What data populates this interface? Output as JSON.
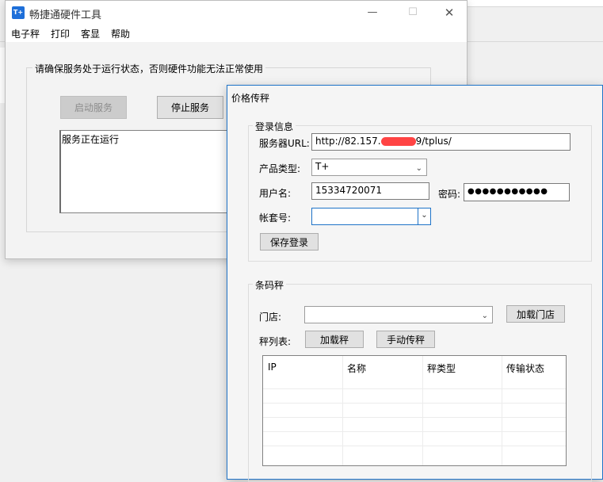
{
  "main_window": {
    "title": "畅捷通硬件工具",
    "icon_text": "T+",
    "controls": {
      "minimize": "—",
      "maximize": "☐",
      "close": "✕"
    },
    "menu": [
      "电子秤",
      "打印",
      "客显",
      "帮助"
    ],
    "service_group_label": "请确保服务处于运行状态，否则硬件功能无法正常使用",
    "start_button": "启动服务",
    "stop_button": "停止服务",
    "status_text": "服务正在运行"
  },
  "dialog": {
    "title": "价格传秤",
    "login_group_label": "登录信息",
    "server_url_label": "服务器URL:",
    "server_url_prefix": "http://82.157.",
    "server_url_suffix": "9/tplus/",
    "product_type_label": "产品类型:",
    "product_type_value": "T+",
    "username_label": "用户名:",
    "username_value": "15334720071",
    "password_label": "密码:",
    "password_value": "●●●●●●●●●●●",
    "account_label": "帐套号:",
    "account_value": "",
    "save_login_button": "保存登录",
    "scale_group_label": "条码秤",
    "store_label": "门店:",
    "store_value": "",
    "load_store_button": "加载门店",
    "scale_list_label": "秤列表:",
    "load_scale_button": "加载秤",
    "manual_transfer_button": "手动传秤",
    "columns": [
      "IP",
      "名称",
      "秤类型",
      "传输状态"
    ]
  }
}
